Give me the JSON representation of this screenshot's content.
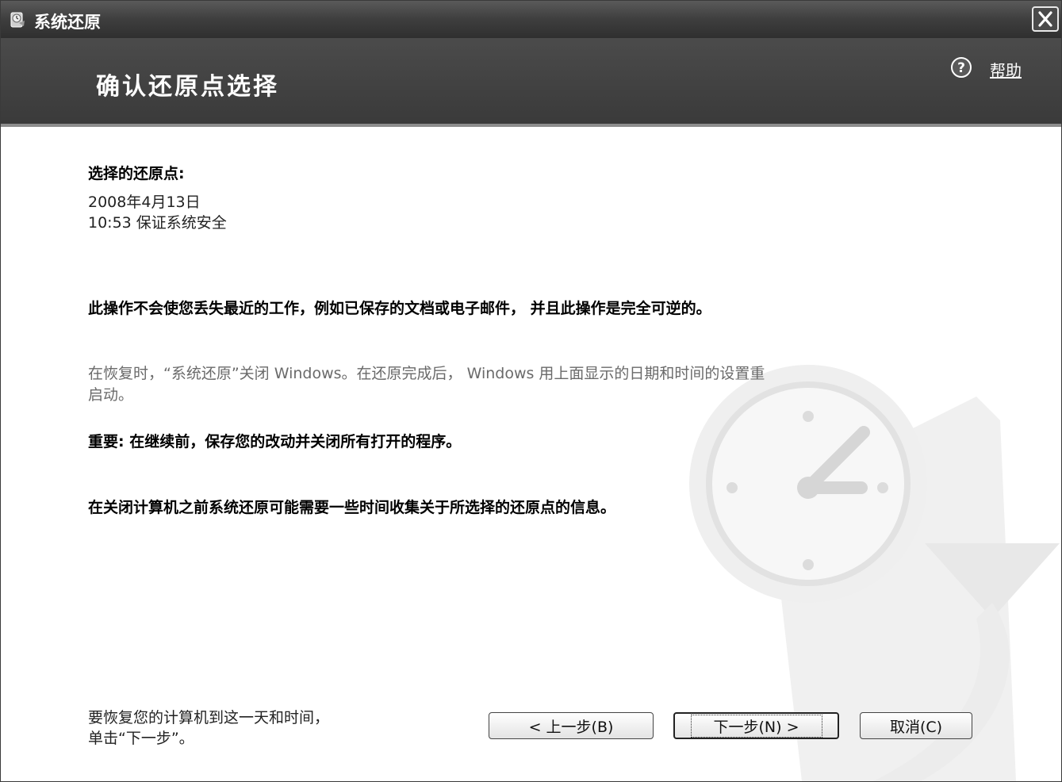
{
  "window": {
    "title": "系统还原"
  },
  "header": {
    "title": "确认还原点选择",
    "help_label": "帮助"
  },
  "restore_point": {
    "label": "选择的还原点:",
    "date": "2008年4月13日",
    "time_description": "10:53 保证系统安全"
  },
  "messages": {
    "safety_notice": "此操作不会使您丢失最近的工作，例如已保存的文档或电子邮件， 并且此操作是完全可逆的。",
    "restart_info_line1": "在恢复时，“系统还原”关闭 Windows。在还原完成后， Windows 用上面显示的日期和时间的设置重",
    "restart_info_line2": "启动。",
    "important": "重要: 在继续前，保存您的改动并关闭所有打开的程序。",
    "collecting_info": "在关闭计算机之前系统还原可能需要一些时间收集关于所选择的还原点的信息。"
  },
  "footer": {
    "instruction_line1": "要恢复您的计算机到这一天和时间，",
    "instruction_line2": "单击“下一步”。"
  },
  "buttons": {
    "back_label": "< 上一步(B)",
    "next_label": "下一步(N) >",
    "cancel_label": "取消(C)"
  }
}
